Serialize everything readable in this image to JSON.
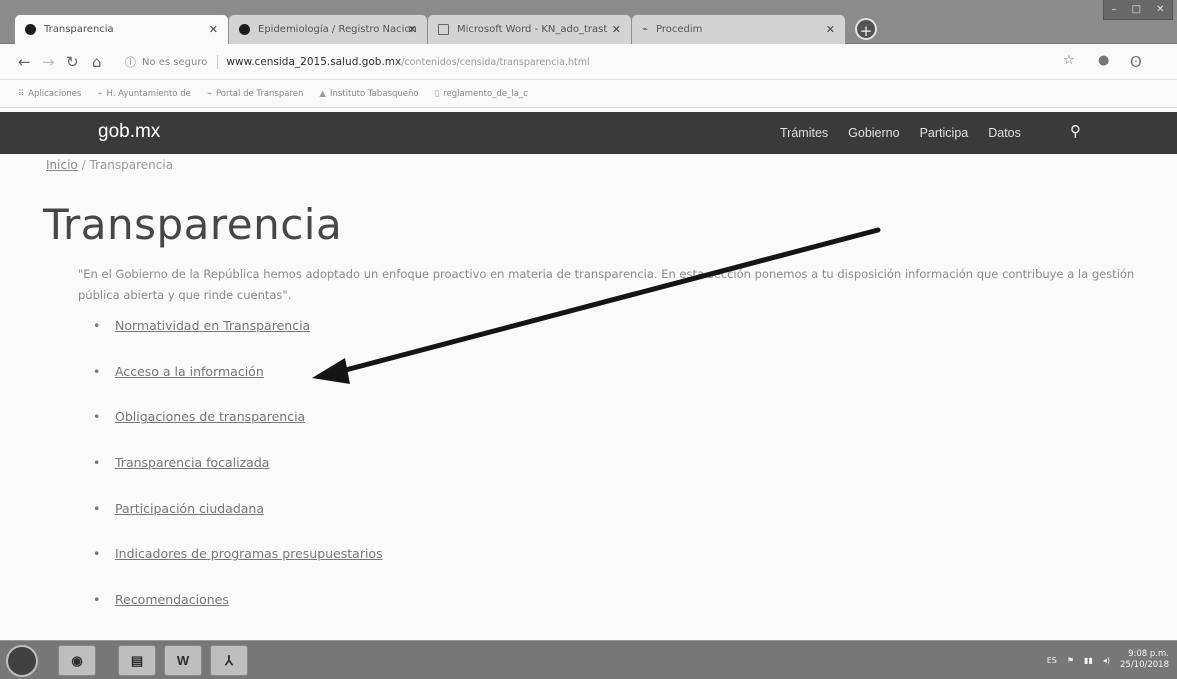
{
  "browser": {
    "tabs": [
      {
        "label": "Transparencia",
        "active": true,
        "icon": "gobmx-favicon-icon"
      },
      {
        "label": "Epidemiología / Registro Nacion",
        "active": false,
        "icon": "gobmx-favicon-icon"
      },
      {
        "label": "Microsoft Word - KN_ado_trast",
        "active": false,
        "icon": "document-icon"
      },
      {
        "label": "Procedim",
        "active": false,
        "icon": "network-icon"
      }
    ],
    "new_tab_label": "+",
    "security_label": "No es seguro",
    "url_host": "www.censida_2015.salud.gob.mx",
    "url_path": "/contenidos/censida/transparencia.html",
    "bookmarks": [
      {
        "label": "Aplicaciones",
        "icon": "apps-grid-icon"
      },
      {
        "label": "H. Ayuntamiento de",
        "icon": "site-icon"
      },
      {
        "label": "Portal de Transparen",
        "icon": "site-icon"
      },
      {
        "label": "Instituto Tabasqueño",
        "icon": "site-icon"
      },
      {
        "label": "reglamento_de_la_c",
        "icon": "document-icon"
      }
    ]
  },
  "site": {
    "brand": "gob.mx",
    "nav": [
      "Trámites",
      "Gobierno",
      "Participa",
      "Datos"
    ],
    "breadcrumb": {
      "home": "Inicio",
      "separator": " / ",
      "current": "Transparencia"
    },
    "title": "Transparencia",
    "intro": "\"En el Gobierno de la República hemos adoptado un enfoque proactivo en materia de transparencia. En esta sección ponemos a tu disposición información que contribuye a la gestión pública abierta y que rinde cuentas\".",
    "links": [
      "Normatividad en Transparencia",
      "Acceso a la información",
      "Obligaciones de transparencia",
      "Transparencia focalizada",
      "Participación ciudadana",
      "Indicadores de programas presupuestarios",
      "Recomendaciones"
    ]
  },
  "taskbar": {
    "apps": [
      "chrome",
      "file-explorer",
      "word",
      "acrobat"
    ],
    "word_label": "W",
    "language": "ES",
    "time": "9:08 p.m.",
    "date": "25/10/2018"
  },
  "colors": {
    "navbar": "#3d3d3d",
    "arrow": "#1a1a1a"
  }
}
